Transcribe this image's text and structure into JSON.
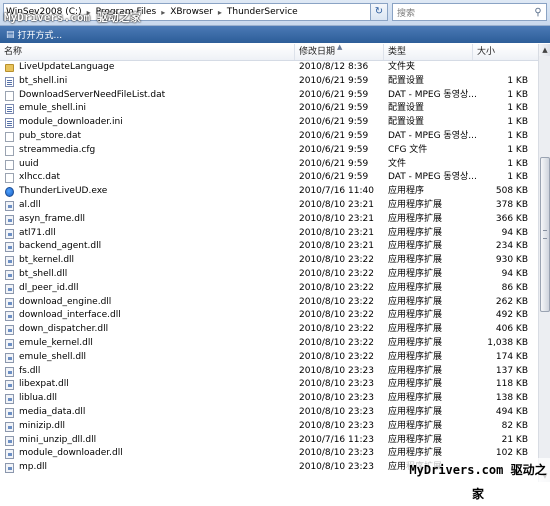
{
  "address": {
    "segments": [
      "WinSev2008 (C:)",
      "Program Files",
      "XBrowser",
      "ThunderService"
    ],
    "refresh_icon": "refresh-icon",
    "dropdown_icon": "chevron-down-icon"
  },
  "search": {
    "placeholder": "搜索",
    "icon": "search-icon"
  },
  "toolbar": {
    "open_label": "打开方式...",
    "open_icon": "open-with-icon"
  },
  "columns": {
    "name": "名称",
    "date": "修改日期",
    "type": "类型",
    "size": "大小"
  },
  "watermark": {
    "top": "MyDrivers.com 驱动之家",
    "bottom": "MyDrivers.com 驱动之家"
  },
  "files": [
    {
      "name": "LiveUpdateLanguage",
      "date": "2010/8/12 8:36",
      "type": "文件夹",
      "size": "",
      "icon": "folder"
    },
    {
      "name": "bt_shell.ini",
      "date": "2010/6/21 9:59",
      "type": "配置设置",
      "size": "1 KB",
      "icon": "ini"
    },
    {
      "name": "DownloadServerNeedFileList.dat",
      "date": "2010/6/21 9:59",
      "type": "DAT - MPEG 동영상...",
      "size": "1 KB",
      "icon": "file"
    },
    {
      "name": "emule_shell.ini",
      "date": "2010/6/21 9:59",
      "type": "配置设置",
      "size": "1 KB",
      "icon": "ini"
    },
    {
      "name": "module_downloader.ini",
      "date": "2010/6/21 9:59",
      "type": "配置设置",
      "size": "1 KB",
      "icon": "ini"
    },
    {
      "name": "pub_store.dat",
      "date": "2010/6/21 9:59",
      "type": "DAT - MPEG 동영상...",
      "size": "1 KB",
      "icon": "file"
    },
    {
      "name": "streammedia.cfg",
      "date": "2010/6/21 9:59",
      "type": "CFG 文件",
      "size": "1 KB",
      "icon": "file"
    },
    {
      "name": "uuid",
      "date": "2010/6/21 9:59",
      "type": "文件",
      "size": "1 KB",
      "icon": "file"
    },
    {
      "name": "xlhcc.dat",
      "date": "2010/6/21 9:59",
      "type": "DAT - MPEG 동영상...",
      "size": "1 KB",
      "icon": "file"
    },
    {
      "name": "ThunderLiveUD.exe",
      "date": "2010/7/16 11:40",
      "type": "应用程序",
      "size": "508 KB",
      "icon": "exe"
    },
    {
      "name": "al.dll",
      "date": "2010/8/10 23:21",
      "type": "应用程序扩展",
      "size": "378 KB",
      "icon": "dll"
    },
    {
      "name": "asyn_frame.dll",
      "date": "2010/8/10 23:21",
      "type": "应用程序扩展",
      "size": "366 KB",
      "icon": "dll"
    },
    {
      "name": "atl71.dll",
      "date": "2010/8/10 23:21",
      "type": "应用程序扩展",
      "size": "94 KB",
      "icon": "dll"
    },
    {
      "name": "backend_agent.dll",
      "date": "2010/8/10 23:21",
      "type": "应用程序扩展",
      "size": "234 KB",
      "icon": "dll"
    },
    {
      "name": "bt_kernel.dll",
      "date": "2010/8/10 23:22",
      "type": "应用程序扩展",
      "size": "930 KB",
      "icon": "dll"
    },
    {
      "name": "bt_shell.dll",
      "date": "2010/8/10 23:22",
      "type": "应用程序扩展",
      "size": "94 KB",
      "icon": "dll"
    },
    {
      "name": "dl_peer_id.dll",
      "date": "2010/8/10 23:22",
      "type": "应用程序扩展",
      "size": "86 KB",
      "icon": "dll"
    },
    {
      "name": "download_engine.dll",
      "date": "2010/8/10 23:22",
      "type": "应用程序扩展",
      "size": "262 KB",
      "icon": "dll"
    },
    {
      "name": "download_interface.dll",
      "date": "2010/8/10 23:22",
      "type": "应用程序扩展",
      "size": "492 KB",
      "icon": "dll"
    },
    {
      "name": "down_dispatcher.dll",
      "date": "2010/8/10 23:22",
      "type": "应用程序扩展",
      "size": "406 KB",
      "icon": "dll"
    },
    {
      "name": "emule_kernel.dll",
      "date": "2010/8/10 23:22",
      "type": "应用程序扩展",
      "size": "1,038 KB",
      "icon": "dll"
    },
    {
      "name": "emule_shell.dll",
      "date": "2010/8/10 23:22",
      "type": "应用程序扩展",
      "size": "174 KB",
      "icon": "dll"
    },
    {
      "name": "fs.dll",
      "date": "2010/8/10 23:23",
      "type": "应用程序扩展",
      "size": "137 KB",
      "icon": "dll"
    },
    {
      "name": "libexpat.dll",
      "date": "2010/8/10 23:23",
      "type": "应用程序扩展",
      "size": "118 KB",
      "icon": "dll"
    },
    {
      "name": "liblua.dll",
      "date": "2010/8/10 23:23",
      "type": "应用程序扩展",
      "size": "138 KB",
      "icon": "dll"
    },
    {
      "name": "media_data.dll",
      "date": "2010/8/10 23:23",
      "type": "应用程序扩展",
      "size": "494 KB",
      "icon": "dll"
    },
    {
      "name": "minizip.dll",
      "date": "2010/8/10 23:23",
      "type": "应用程序扩展",
      "size": "82 KB",
      "icon": "dll"
    },
    {
      "name": "mini_unzip_dll.dll",
      "date": "2010/7/16 11:23",
      "type": "应用程序扩展",
      "size": "21 KB",
      "icon": "dll"
    },
    {
      "name": "module_downloader.dll",
      "date": "2010/8/10 23:23",
      "type": "应用程序扩展",
      "size": "102 KB",
      "icon": "dll"
    },
    {
      "name": "mp.dll",
      "date": "2010/8/10 23:23",
      "type": "应用程序扩展",
      "size": "",
      "icon": "dll"
    }
  ]
}
